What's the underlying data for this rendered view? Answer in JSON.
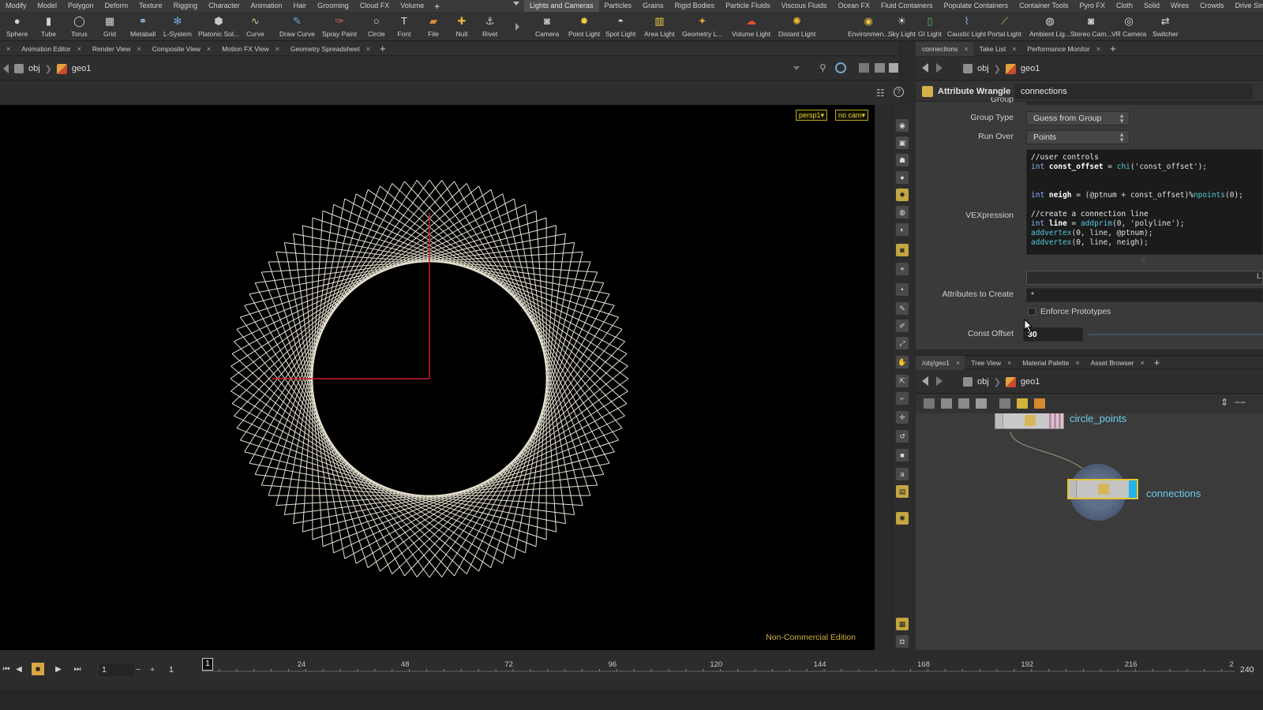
{
  "menu_left": [
    "Modify",
    "Model",
    "Polygon",
    "Deform",
    "Texture",
    "Rigging",
    "Character",
    "Animation",
    "Hair",
    "Grooming",
    "Cloud FX",
    "Volume"
  ],
  "menu_right": [
    "Lights and Cameras",
    "Particles",
    "Grains",
    "Rigid Bodies",
    "Particle Fluids",
    "Viscous Fluids",
    "Ocean FX",
    "Fluid Containers",
    "Populate Containers",
    "Container Tools",
    "Pyro FX",
    "Cloth",
    "Solid",
    "Wires",
    "Crowds",
    "Drive Simu"
  ],
  "shelf_left": [
    {
      "label": "Sphere",
      "icon": "sphere-icon"
    },
    {
      "label": "Tube",
      "icon": "tube-icon"
    },
    {
      "label": "Torus",
      "icon": "torus-icon"
    },
    {
      "label": "Grid",
      "icon": "grid-icon"
    },
    {
      "label": "Metaball",
      "icon": "metaball-icon"
    },
    {
      "label": "L-System",
      "icon": "lsystem-icon"
    },
    {
      "label": "Platonic Sol...",
      "icon": "platonic-icon"
    },
    {
      "label": "Curve",
      "icon": "curve-icon"
    },
    {
      "label": "Draw Curve",
      "icon": "draw-curve-icon"
    },
    {
      "label": "Spray Paint",
      "icon": "spray-paint-icon"
    },
    {
      "label": "Circle",
      "icon": "circle-icon"
    },
    {
      "label": "Font",
      "icon": "font-icon"
    },
    {
      "label": "File",
      "icon": "file-icon"
    },
    {
      "label": "Null",
      "icon": "null-icon"
    },
    {
      "label": "Rivet",
      "icon": "rivet-icon"
    }
  ],
  "shelf_right": [
    {
      "label": "Camera",
      "icon": "camera-icon"
    },
    {
      "label": "Point Light",
      "icon": "point-light-icon"
    },
    {
      "label": "Spot Light",
      "icon": "spot-light-icon"
    },
    {
      "label": "Area Light",
      "icon": "area-light-icon"
    },
    {
      "label": "Geometry L...",
      "icon": "geometry-light-icon"
    },
    {
      "label": "Volume Light",
      "icon": "volume-light-icon"
    },
    {
      "label": "Distant Light",
      "icon": "distant-light-icon"
    },
    {
      "label": "Environmen...",
      "icon": "environment-light-icon"
    },
    {
      "label": "Sky Light",
      "icon": "sky-light-icon"
    },
    {
      "label": "GI Light",
      "icon": "gi-light-icon"
    },
    {
      "label": "Caustic Light",
      "icon": "caustic-light-icon"
    },
    {
      "label": "Portal Light",
      "icon": "portal-light-icon"
    },
    {
      "label": "Ambient Lig...",
      "icon": "ambient-light-icon"
    },
    {
      "label": "Stereo Cam...",
      "icon": "stereo-camera-icon"
    },
    {
      "label": "VR Camera",
      "icon": "vr-camera-icon"
    },
    {
      "label": "Switcher",
      "icon": "switcher-icon"
    }
  ],
  "left_tabs": [
    "Animation Editor",
    "Render View",
    "Composite View",
    "Motion FX View",
    "Geometry Spreadsheet"
  ],
  "left_path": {
    "obj": "obj",
    "geo": "geo1"
  },
  "viewport": {
    "camera": "persp1",
    "cam_menu": "no cam",
    "edition": "Non-Commercial Edition"
  },
  "right_tabs": [
    "connections",
    "Take List",
    "Performance Monitor"
  ],
  "right_path": {
    "obj": "obj",
    "geo": "geo1"
  },
  "params": {
    "node_type": "Attribute Wrangle",
    "node_name": "connections",
    "group_label": "Group",
    "group_type_label": "Group Type",
    "group_type_value": "Guess from Group",
    "run_over_label": "Run Over",
    "run_over_value": "Points",
    "vex_label": "VEXpression",
    "vex_lines": [
      "//user controls",
      "int const_offset = chi('const_offset');",
      "",
      "",
      "int neigh = (@ptnum + const_offset)%npoints(0);",
      "",
      "//create a connection line",
      "int line = addprim(0, 'polyline');",
      "addvertex(0, line, @ptnum);",
      "addvertex(0, line, neigh);"
    ],
    "attrs_label": "Attributes to Create",
    "attrs_value": "*",
    "enforce_label": "Enforce Prototypes",
    "offset_label": "Const Offset",
    "offset_value": "30",
    "side_btn": "L"
  },
  "net_tabs": [
    "/obj/geo1",
    "Tree View",
    "Material Palette",
    "Asset Browser"
  ],
  "net_path": {
    "obj": "obj",
    "geo": "geo1"
  },
  "nodes": [
    {
      "name": "circle_points"
    },
    {
      "name": "connections"
    }
  ],
  "timeline": {
    "frame": "1",
    "start": "1",
    "end": "240",
    "current_marker": "1",
    "ticks": [
      "24",
      "48",
      "72",
      "96",
      "120",
      "144",
      "168",
      "192",
      "216"
    ],
    "last_tick": "2"
  },
  "colors": {
    "accent_blue": "#5dc3e4",
    "node_selected": "#e6c431",
    "viewport_bg": "#000000",
    "edition_text": "#d2b23c",
    "axis_red": "#d1192e"
  }
}
